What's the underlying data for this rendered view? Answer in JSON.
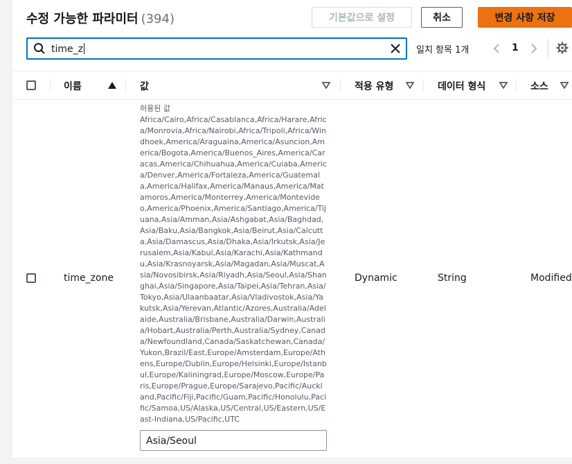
{
  "header": {
    "title": "수정 가능한 파라미터",
    "count": "(394)",
    "reset_button": "기본값으로 설정",
    "cancel_button": "취소",
    "save_button": "변경 사항 저장"
  },
  "search": {
    "value": "time_z"
  },
  "pagination": {
    "matches_label": "일치 항목 1개",
    "current_page": "1"
  },
  "table": {
    "columns": [
      "이름",
      "값",
      "적용 유형",
      "데이터 형식",
      "소스"
    ],
    "rows": [
      {
        "name": "time_zone",
        "allowed_values_label": "허용된 값",
        "allowed_values": "Africa/Cairo,Africa/Casablanca,Africa/Harare,Africa/Monrovia,Africa/Nairobi,Africa/Tripoli,Africa/Windhoek,America/Araguaina,America/Asuncion,America/Bogota,America/Buenos_Aires,America/Caracas,America/Chihuahua,America/Cuiaba,America/Denver,America/Fortaleza,America/Guatemala,America/Halifax,America/Manaus,America/Matamoros,America/Monterrey,America/Montevideo,America/Phoenix,America/Santiago,America/Tijuana,Asia/Amman,Asia/Ashgabat,Asia/Baghdad,Asia/Baku,Asia/Bangkok,Asia/Beirut,Asia/Calcutta,Asia/Damascus,Asia/Dhaka,Asia/Irkutsk,Asia/Jerusalem,Asia/Kabul,Asia/Karachi,Asia/Kathmandu,Asia/Krasnoyarsk,Asia/Magadan,Asia/Muscat,Asia/Novosibirsk,Asia/Riyadh,Asia/Seoul,Asia/Shanghai,Asia/Singapore,Asia/Taipei,Asia/Tehran,Asia/Tokyo,Asia/Ulaanbaatar,Asia/Vladivostok,Asia/Yakutsk,Asia/Yerevan,Atlantic/Azores,Australia/Adelaide,Australia/Brisbane,Australia/Darwin,Australia/Hobart,Australia/Perth,Australia/Sydney,Canada/Newfoundland,Canada/Saskatchewan,Canada/Yukon,Brazil/East,Europe/Amsterdam,Europe/Athens,Europe/Dublin,Europe/Helsinki,Europe/Istanbul,Europe/Kaliningrad,Europe/Moscow,Europe/Paris,Europe/Prague,Europe/Sarajevo,Pacific/Auckland,Pacific/Fiji,Pacific/Guam,Pacific/Honolulu,Pacific/Samoa,US/Alaska,US/Central,US/Eastern,US/East-Indiana,US/Pacific,UTC",
        "value": "Asia/Seoul",
        "apply_type": "Dynamic",
        "data_type": "String",
        "source": "Modified"
      }
    ]
  },
  "icons": {
    "search": "search-icon",
    "clear": "close-icon",
    "prev": "chevron-left-icon",
    "next": "chevron-right-icon",
    "settings": "gear-icon",
    "sort": "sort-ascending-icon",
    "filter": "caret-down-icon"
  },
  "colors": {
    "primary": "#ec7211",
    "focus": "#0073bb",
    "text": "#16191f",
    "muted": "#545b64"
  }
}
